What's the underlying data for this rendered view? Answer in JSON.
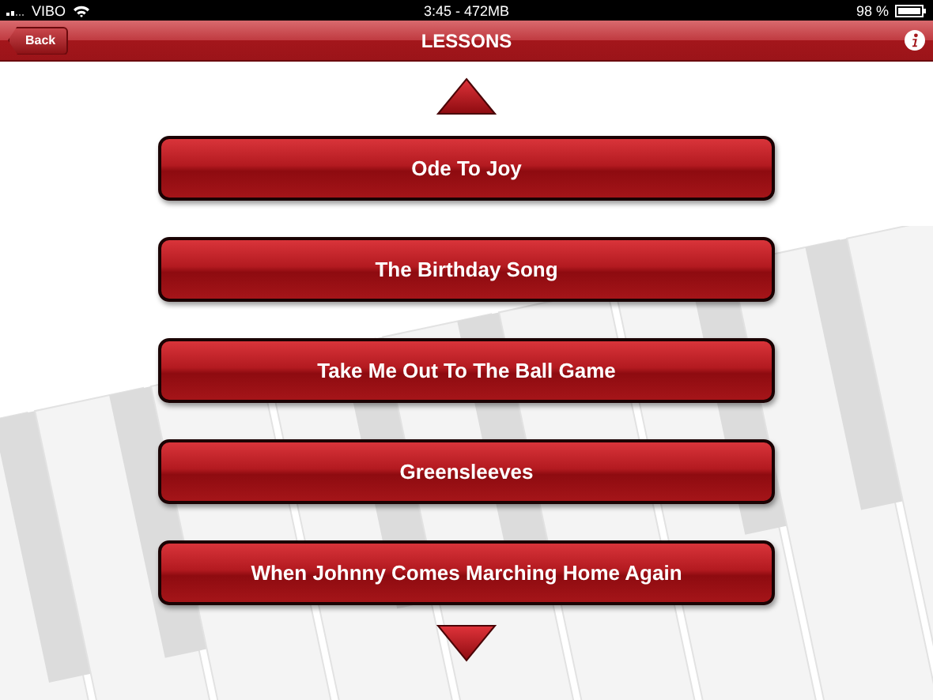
{
  "status_bar": {
    "carrier": "VIBO",
    "time": "3:45 - 472MB",
    "battery": "98 %"
  },
  "nav_bar": {
    "back": "Back",
    "title": "LESSONS"
  },
  "lessons": [
    {
      "title": "Ode To Joy"
    },
    {
      "title": "The Birthday Song"
    },
    {
      "title": "Take Me Out To The Ball Game"
    },
    {
      "title": "Greensleeves"
    },
    {
      "title": "When Johnny Comes Marching Home Again"
    }
  ]
}
